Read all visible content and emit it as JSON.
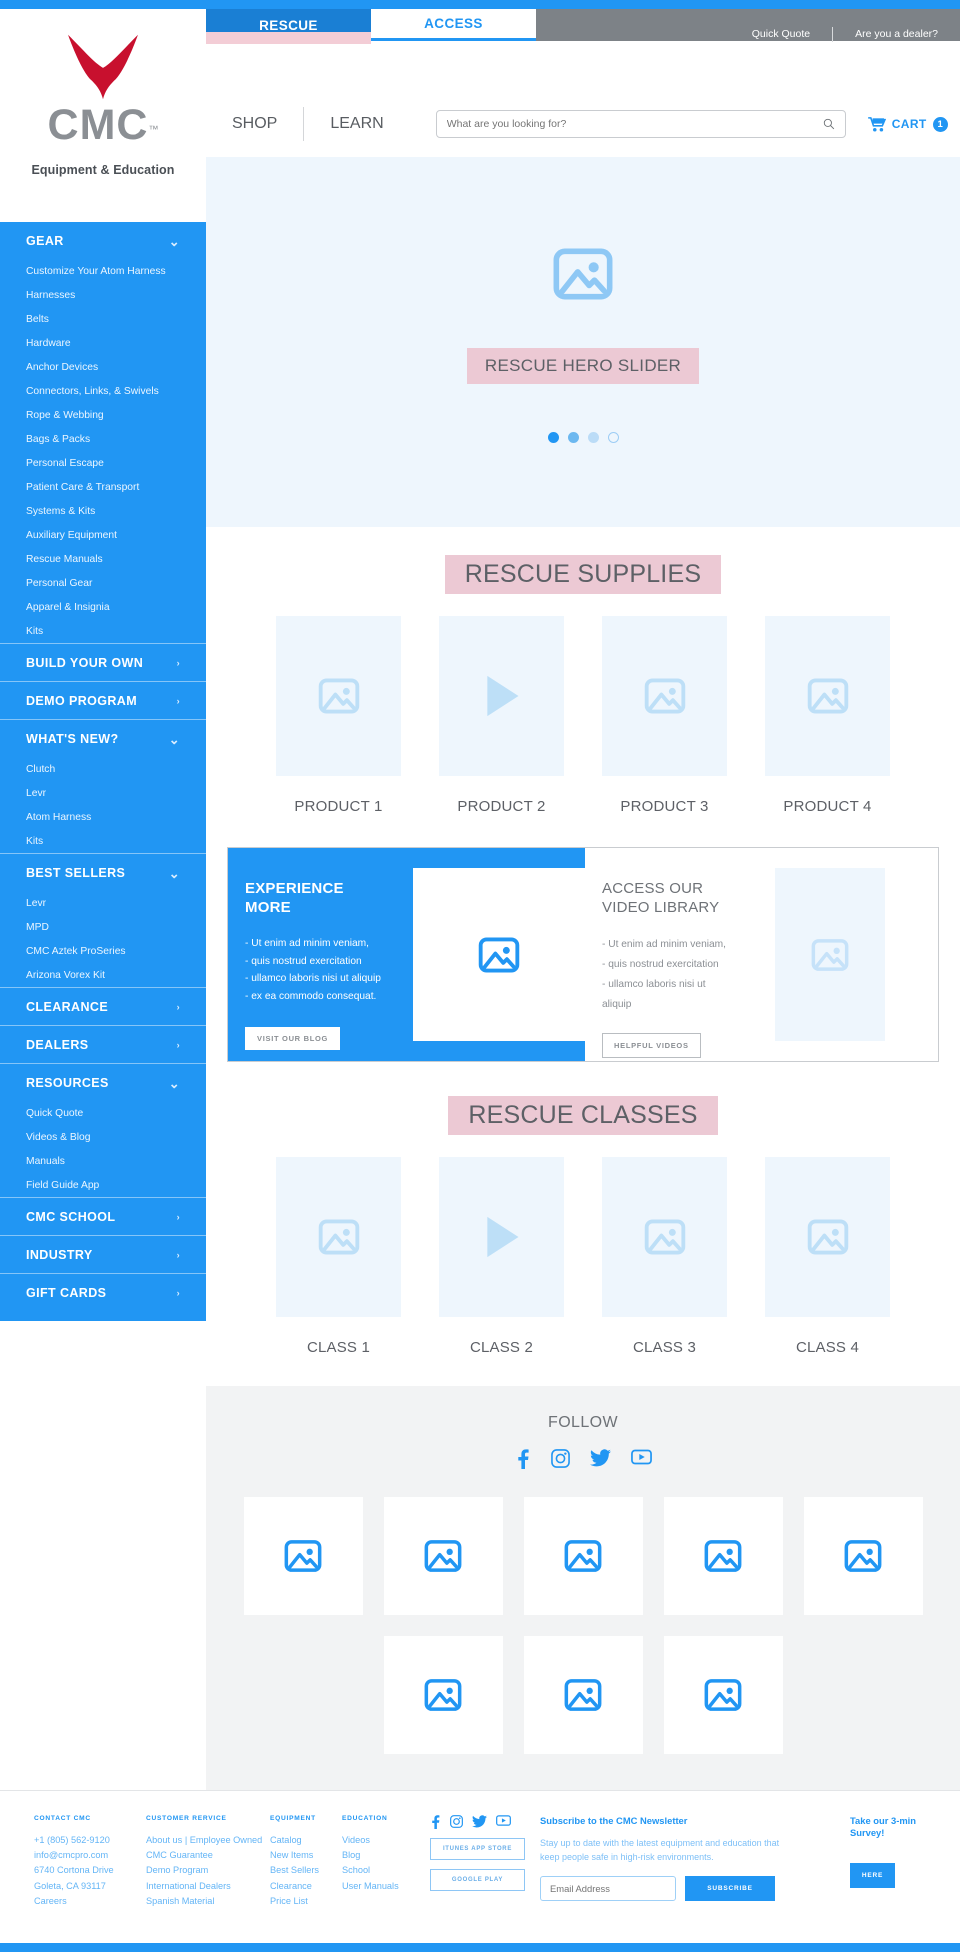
{
  "brand": {
    "name": "CMC",
    "tagline": "Equipment & Education",
    "tm": "™"
  },
  "topbar": {
    "tabs": [
      {
        "label": "RESCUE",
        "active": true
      },
      {
        "label": "ACCESS",
        "active": false
      }
    ],
    "links": [
      "Quick Quote",
      "Are you a dealer?"
    ]
  },
  "navbar": {
    "shop": "SHOP",
    "learn": "LEARN",
    "search_placeholder": "What are you looking for?",
    "cart_label": "CART",
    "cart_count": "1"
  },
  "sidebar": {
    "groups": [
      {
        "title": "GEAR",
        "chevron": "down",
        "items": [
          "Customize Your Atom Harness",
          "Harnesses",
          "Belts",
          "Hardware",
          "Anchor Devices",
          "Connectors, Links, & Swivels",
          "Rope & Webbing",
          "Bags & Packs",
          "Personal Escape",
          "Patient Care & Transport",
          "Systems & Kits",
          "Auxiliary Equipment",
          "Rescue Manuals",
          "Personal Gear",
          "Apparel & Insignia",
          "Kits"
        ]
      },
      {
        "title": "BUILD YOUR OWN",
        "chevron": "right",
        "items": []
      },
      {
        "title": "DEMO PROGRAM",
        "chevron": "right",
        "items": []
      },
      {
        "title": "WHAT'S NEW?",
        "chevron": "down",
        "items": [
          "Clutch",
          "Levr",
          "Atom Harness",
          "Kits"
        ]
      },
      {
        "title": "BEST SELLERS",
        "chevron": "down",
        "items": [
          "Levr",
          "MPD",
          "CMC Aztek ProSeries",
          "Arizona Vorex Kit"
        ]
      },
      {
        "title": "CLEARANCE",
        "chevron": "right",
        "items": []
      },
      {
        "title": "DEALERS",
        "chevron": "right",
        "items": []
      },
      {
        "title": "RESOURCES",
        "chevron": "down",
        "items": [
          "Quick Quote",
          "Videos & Blog",
          "Manuals",
          "Field Guide App"
        ]
      },
      {
        "title": "CMC SCHOOL",
        "chevron": "right",
        "items": []
      },
      {
        "title": "INDUSTRY",
        "chevron": "right",
        "items": []
      },
      {
        "title": "GIFT CARDS",
        "chevron": "right",
        "items": []
      }
    ]
  },
  "hero": {
    "placeholder_label": "RESCUE HERO SLIDER",
    "dots": 4,
    "active_dot": 1
  },
  "supplies": {
    "title": "RESCUE SUPPLIES",
    "cards": [
      {
        "label": "PRODUCT 1",
        "icon": "image"
      },
      {
        "label": "PRODUCT 2",
        "icon": "play"
      },
      {
        "label": "PRODUCT 3",
        "icon": "image"
      },
      {
        "label": "PRODUCT 4",
        "icon": "image"
      }
    ]
  },
  "promo": {
    "left": {
      "title": "EXPERIENCE\nMORE",
      "bullets": [
        "- Ut enim ad minim veniam,",
        "- quis nostrud exercitation",
        "- ullamco laboris nisi ut aliquip",
        "- ex ea commodo consequat."
      ],
      "button": "VISIT OUR BLOG"
    },
    "right": {
      "title": "ACCESS OUR\nVIDEO LIBRARY",
      "bullets": [
        "- Ut enim ad minim veniam,",
        "- quis nostrud exercitation",
        "- ullamco laboris nisi ut",
        "aliquip"
      ],
      "button": "HELPFUL VIDEOS"
    }
  },
  "classes": {
    "title": "RESCUE CLASSES",
    "cards": [
      {
        "label": "CLASS 1",
        "icon": "image"
      },
      {
        "label": "CLASS 2",
        "icon": "play"
      },
      {
        "label": "CLASS 3",
        "icon": "image"
      },
      {
        "label": "CLASS 4",
        "icon": "image"
      }
    ]
  },
  "follow": {
    "heading": "FOLLOW",
    "socials": [
      "facebook-icon",
      "instagram-icon",
      "twitter-icon",
      "youtube-icon"
    ],
    "tiles": 8
  },
  "footer": {
    "columns": [
      {
        "heading": "CONTACT CMC",
        "links": [
          "+1 (805) 562-9120",
          "info@cmcpro.com",
          "6740 Cortona Drive",
          "Goleta, CA 93117",
          "Careers"
        ]
      },
      {
        "heading": "CUSTOMER RERVICE",
        "links": [
          "About us | Employee Owned",
          "CMC Guarantee",
          "Demo Program",
          "International Dealers",
          "Spanish Material"
        ]
      },
      {
        "heading": "EQUIPMENT",
        "links": [
          "Catalog",
          "New Items",
          "Best Sellers",
          "Clearance",
          "Price List"
        ]
      },
      {
        "heading": "EDUCATION",
        "links": [
          "Videos",
          "Blog",
          "School",
          "User Manuals"
        ]
      }
    ],
    "socials": [
      "facebook-icon",
      "instagram-icon",
      "twitter-icon",
      "youtube-icon"
    ],
    "app_buttons": [
      "ITUNES APP STORE",
      "GOOGLE PLAY"
    ],
    "newsletter": {
      "heading": "Subscribe to the CMC Newsletter",
      "body": "Stay up to date with the latest equipment and education that keep people safe in high-risk environments.",
      "input_placeholder": "Email Address",
      "button": "SUBSCRIBE"
    },
    "survey": {
      "text": "Take our 3-min Survey!",
      "button": "HERE"
    }
  },
  "colors": {
    "brand_blue": "#2196f3",
    "tab_active_blue": "#1a7fd4",
    "pink_highlight": "#ecc9d4",
    "logo_red": "#c8102e",
    "logo_gray": "#8b8f94",
    "light_blue_bg": "#eef6fd"
  }
}
